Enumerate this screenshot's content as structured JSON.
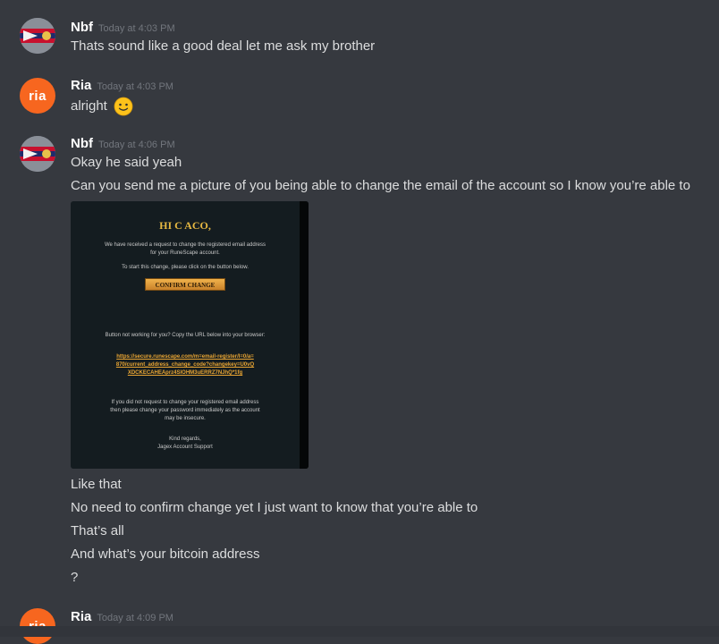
{
  "messages": [
    {
      "author": "Nbf",
      "time": "Today at 4:03 PM",
      "lines": [
        "Thats sound like a good deal let me ask my brother"
      ]
    },
    {
      "author": "Ria",
      "time": "Today at 4:03 PM",
      "lines": [
        "alright"
      ],
      "emoji": "slightly-smiling-face"
    },
    {
      "author": "Nbf",
      "time": "Today at 4:06 PM",
      "lines": [
        "Okay he said yeah",
        "Can you send me a picture of you being able to change the email of the account so I know you’re able to",
        "Like that",
        "No need to confirm change yet I just want to know that you’re able to",
        "That’s all",
        "And what’s your bitcoin address",
        "?"
      ]
    },
    {
      "author": "Ria",
      "time": "Today at 4:09 PM",
      "lines": []
    }
  ],
  "avatar_ria_text": "ria",
  "attachment": {
    "title": "HI C ACO,",
    "para1": "We have received a request to change the registered email address for your RuneScape account.",
    "para2": "To start this change, please click on the button below.",
    "button": "CONFIRM CHANGE",
    "para3": "Button not working for you? Copy the URL below into your browser:",
    "link": "https://secure.runescape.com/m=email-register/l=0/a=870/current_address_change_code?changekey=U0vQXDCKECAHEAprz4SlOHM3uERRZ7NJhQ*1fg",
    "para4": "If you did not request to change your registered email address then please change your password immediately as the account may be insecure.",
    "signoff": "Kind regards,",
    "signature": "Jagex Account Support"
  },
  "colors": {
    "background": "#36393f",
    "text": "#dcddde",
    "username": "#ffffff",
    "timestamp": "#72767d",
    "ria_avatar": "#f7661f",
    "gold": "#e6b842"
  }
}
